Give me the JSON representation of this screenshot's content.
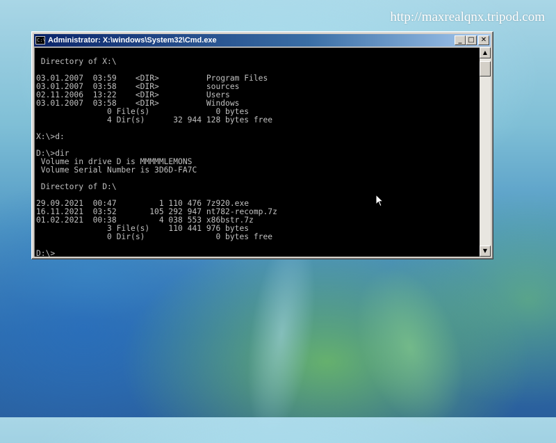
{
  "watermark": "http://maxrealqnx.tripod.com",
  "window": {
    "title": "Administrator: X:\\windows\\System32\\Cmd.exe",
    "icon_text": "C:\\",
    "buttons": {
      "minimize": "_",
      "maximize": "□",
      "close": "✕"
    }
  },
  "console": {
    "text": "\n Directory of X:\\\n\n03.01.2007  03:59    <DIR>          Program Files\n03.01.2007  03:58    <DIR>          sources\n02.11.2006  13:22    <DIR>          Users\n03.01.2007  03:58    <DIR>          Windows\n               0 File(s)              0 bytes\n               4 Dir(s)      32 944 128 bytes free\n\nX:\\>d:\n\nD:\\>dir\n Volume in drive D is MMMMMLEMONS\n Volume Serial Number is 3D6D-FA7C\n\n Directory of D:\\\n\n29.09.2021  00:47         1 110 476 7z920.exe\n16.11.2021  03:52       105 292 947 nt782-recomp.7z\n01.02.2021  00:38         4 038 553 x86bstr.7z\n               3 File(s)    110 441 976 bytes\n               0 Dir(s)               0 bytes free\n\nD:\\>"
  },
  "scrollbar": {
    "up_arrow": "▲",
    "down_arrow": "▼"
  },
  "icons": {
    "cursor": "mouse-pointer-icon"
  },
  "colors": {
    "console_bg": "#000000",
    "console_fg": "#c0c0c0",
    "titlebar_start": "#0a246a",
    "titlebar_end": "#a6caf0",
    "chrome": "#d4d0c8"
  }
}
